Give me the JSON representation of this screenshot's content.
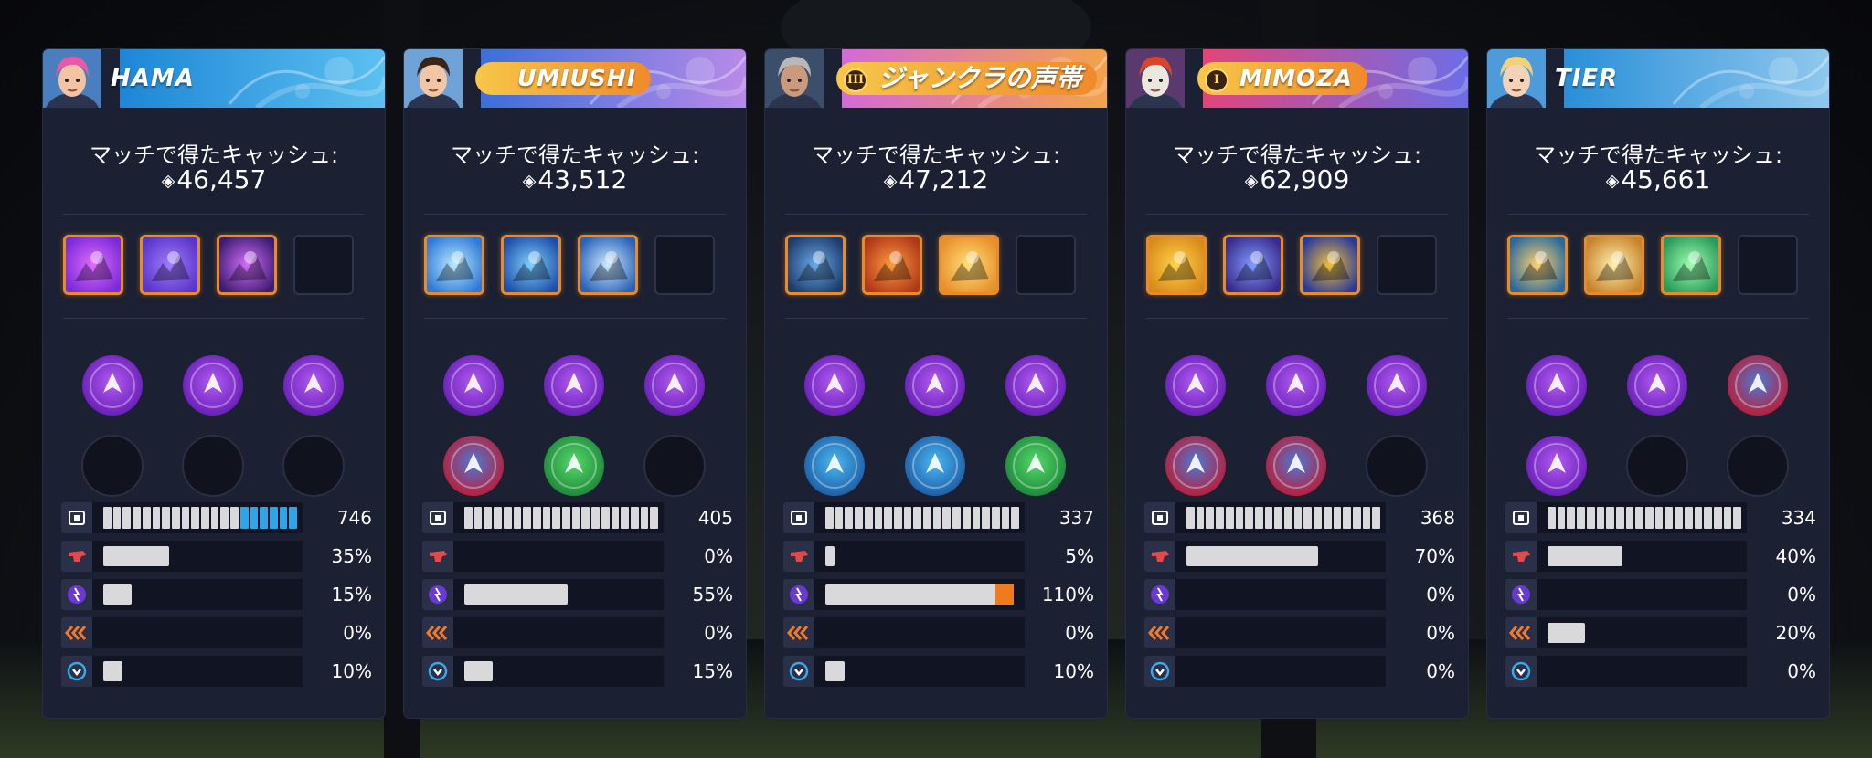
{
  "cash_label": "マッチで得たキャッシュ:",
  "cash_icon": "cash-gem-icon",
  "stat_icons": [
    "weapon-damage-icon",
    "ability-damage-icon",
    "healing-icon",
    "attack-speed-icon",
    "cooldown-icon"
  ],
  "players": [
    {
      "name": "HAMA",
      "name_style": "plain",
      "badge": "",
      "cash": "46,457",
      "hero_portrait": "zarya-portrait-icon",
      "items": [
        "shield-hexagon-item-icon",
        "energy-orb-item-icon",
        "particle-blast-item-icon",
        "empty"
      ],
      "powers_row1": [
        "pulse-dagger-power-icon",
        "dash-strike-power-icon",
        "rotating-bubble-power-icon"
      ],
      "powers_row2": [
        "empty",
        "empty",
        "empty"
      ],
      "stats": {
        "level": "746",
        "weapon": "35%",
        "ability": "15%",
        "speed": "0%",
        "cooldown": "10%"
      },
      "fills": {
        "level_blue_segments": 6,
        "weapon": 0.35,
        "ability": 0.15,
        "speed": 0.0,
        "cooldown": 0.1
      }
    },
    {
      "name": "UMIUSHI",
      "name_style": "pill",
      "badge": "",
      "cash": "43,512",
      "hero_portrait": "mei-portrait-icon",
      "items": [
        "ice-blaster-item-icon",
        "ice-wall-item-icon",
        "cryo-freeze-item-icon",
        "empty"
      ],
      "powers_row1": [
        "target-reticle-power-icon",
        "heal-boost-power-icon",
        "charge-ring-power-icon"
      ],
      "powers_row2": [
        "red-hero-power-icon",
        "green-ring-power-icon",
        "empty"
      ],
      "stats": {
        "level": "405",
        "weapon": "0%",
        "ability": "55%",
        "speed": "0%",
        "cooldown": "15%"
      },
      "fills": {
        "level_blue_segments": 0,
        "weapon": 0.0,
        "ability": 0.55,
        "speed": 0.0,
        "cooldown": 0.15
      }
    },
    {
      "name": "ジャンクラの声帯",
      "name_style": "pill-square",
      "badge": "III",
      "cash": "47,212",
      "hero_portrait": "soldier-portrait-icon",
      "items": [
        "rifle-burst-item-icon",
        "tactical-visor-item-icon",
        "helix-rocket-item-icon",
        "empty"
      ],
      "powers_row1": [
        "burst-shield-power-icon",
        "target-reticle-power-icon",
        "charge-ring-power-icon"
      ],
      "powers_row2": [
        "blue-burst-power-icon",
        "blue-blast-power-icon",
        "green-burst-power-icon"
      ],
      "stats": {
        "level": "337",
        "weapon": "5%",
        "ability": "110%",
        "speed": "0%",
        "cooldown": "10%"
      },
      "fills": {
        "level_blue_segments": 0,
        "weapon": 0.05,
        "ability": 1.1,
        "speed": 0.0,
        "cooldown": 0.1
      }
    },
    {
      "name": "MIMOZA",
      "name_style": "pill",
      "badge": "I",
      "cash": "62,909",
      "hero_portrait": "moira-portrait-icon",
      "items": [
        "biotic-grasp-item-icon",
        "fade-item-icon",
        "coalescence-item-icon",
        "empty"
      ],
      "powers_row1": [
        "pulse-dagger-power-icon",
        "heal-cross-power-icon",
        "group-heal-power-icon"
      ],
      "powers_row2": [
        "red-shield-power-icon",
        "red-orb-power-icon",
        "empty"
      ],
      "stats": {
        "level": "368",
        "weapon": "70%",
        "ability": "0%",
        "speed": "0%",
        "cooldown": "0%"
      },
      "fills": {
        "level_blue_segments": 0,
        "weapon": 0.7,
        "ability": 0.0,
        "speed": 0.0,
        "cooldown": 0.0
      }
    },
    {
      "name": "TIER",
      "name_style": "plain",
      "badge": "",
      "cash": "45,661",
      "hero_portrait": "mercy-portrait-icon",
      "items": [
        "guardian-angel-item-icon",
        "valkyrie-item-icon",
        "resurrect-item-icon",
        "empty"
      ],
      "powers_row1": [
        "group-heal-power-icon",
        "dash-arrows-power-icon",
        "red-target-power-icon"
      ],
      "powers_row2": [
        "shield-slash-power-icon",
        "empty",
        "empty"
      ],
      "stats": {
        "level": "334",
        "weapon": "40%",
        "ability": "0%",
        "speed": "20%",
        "cooldown": "0%"
      },
      "fills": {
        "level_blue_segments": 0,
        "weapon": 0.4,
        "ability": 0.0,
        "speed": 0.2,
        "cooldown": 0.0
      }
    }
  ]
}
